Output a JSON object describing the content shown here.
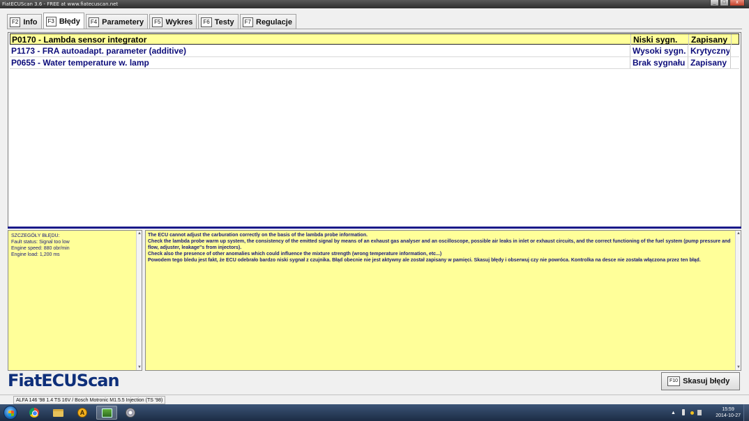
{
  "window": {
    "title": "FiatECUScan 3.6 - FREE at www.fiatecuscan.net",
    "min": "_",
    "max": "□",
    "close": "x"
  },
  "tabs": [
    {
      "key": "F2",
      "label": "Info"
    },
    {
      "key": "F3",
      "label": "Błędy"
    },
    {
      "key": "F4",
      "label": "Parametery"
    },
    {
      "key": "F5",
      "label": "Wykres"
    },
    {
      "key": "F6",
      "label": "Testy"
    },
    {
      "key": "F7",
      "label": "Regulacje"
    }
  ],
  "errors": [
    {
      "code": "P0170 - Lambda sensor integrator",
      "signal": "Niski sygn.",
      "status": "Zapisany"
    },
    {
      "code": "P1173 - FRA autoadapt. parameter (additive)",
      "signal": "Wysoki sygn.",
      "status": "Krytyczny"
    },
    {
      "code": "P0655 - Water temperature w. lamp",
      "signal": "Brak sygnału",
      "status": "Zapisany"
    }
  ],
  "details": {
    "heading": "SZCZEGÓŁY BŁĘDU:",
    "lines": [
      "Fault status: Signal too low",
      "Engine speed: 880 obr/min",
      "Engine load: 1,200 ms"
    ]
  },
  "description": {
    "lines": [
      "The ECU cannot adjust the carburation correctly on the basis of the lambda probe information.",
      "Check the lambda probe warm up system, the consistency of the emitted signal by means of an exhaust gas analyser and an oscilloscope, possible air leaks in inlet or exhaust circuits, and the correct functioning of the fuel system (pump pressure and flow, adjuster, leakage\"s from injectors).",
      "Check also the presence of other anomalies which could influence the mixture strength (wrong temperature information, etc...)",
      "Powodem tego bledu jest fakt, że ECU odebrało bardzo niski sygnał z czujnika. Błąd obecnie nie jest aktywny ale został zapisany w pamięci. Skasuj błędy i obserwuj czy nie powróca. Kontrolka na desce nie została włączona przez ten błąd."
    ]
  },
  "logo": "FiatECUScan",
  "clear_button": {
    "key": "F10",
    "label": "Skasuj błędy"
  },
  "statusbar": {
    "vehicle": "ALFA 146 '98 1.4 TS 16V / Bosch Motronic M1.5.5 Injection (TS '98)"
  },
  "scroll": {
    "up": "▲",
    "down": "▼"
  },
  "tray": {
    "arrow": "▲",
    "time": "15:59",
    "date": "2014-10-27"
  },
  "colors": {
    "selected_row": "#ffff99",
    "panel_yellow": "#ffff99",
    "text_navy": "#0c0c7a",
    "logo": "#0e2f7a"
  }
}
